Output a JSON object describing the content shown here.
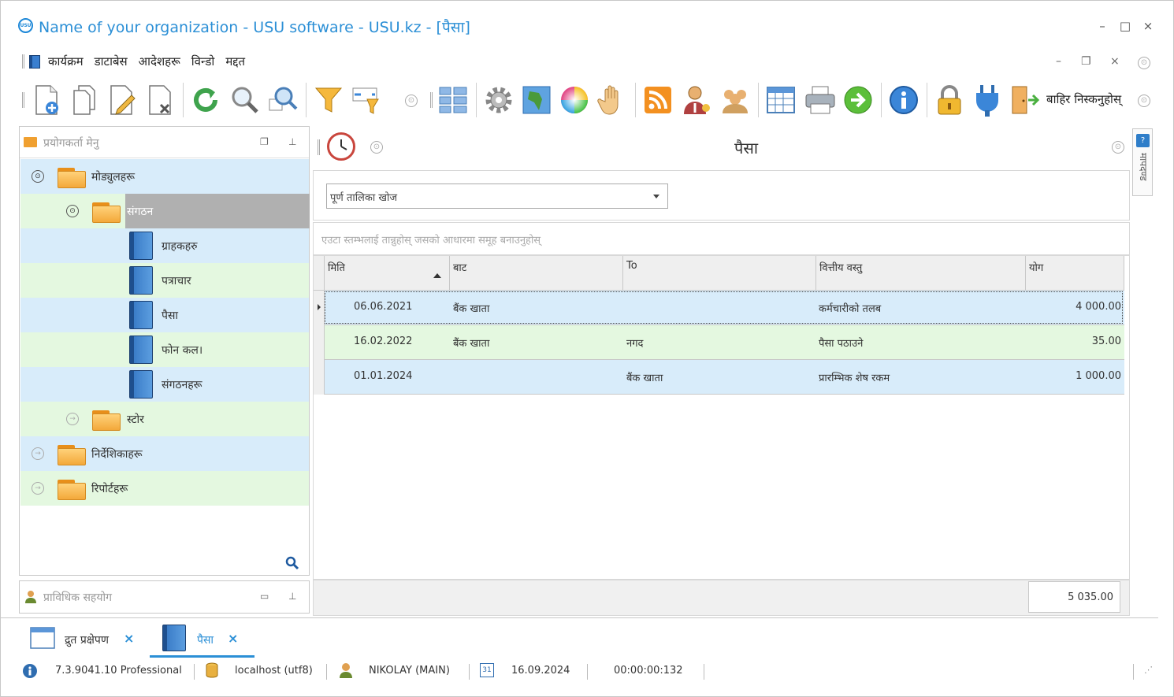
{
  "window": {
    "title": "Name of your organization - USU software - USU.kz - [पैसा]",
    "logo_text": "USU",
    "minimize": "–",
    "maximize": "□",
    "close": "×"
  },
  "menu": {
    "items": [
      "कार्यक्रम",
      "डाटाबेस",
      "आदेशहरू",
      "विन्डो",
      "मद्दत"
    ]
  },
  "mdi_controls": {
    "minimize": "–",
    "restore": "❐",
    "close": "×"
  },
  "toolbar": {
    "exit_label": "बाहिर निस्कनुहोस्"
  },
  "left_panel": {
    "title": "प्रयोगकर्ता मेनु",
    "tree": [
      {
        "label": "मोड्युलहरू",
        "type": "folder",
        "level": 0,
        "expanded": true
      },
      {
        "label": "संगठन",
        "type": "folder",
        "level": 1,
        "expanded": true,
        "selected": true
      },
      {
        "label": "ग्राहकहरु",
        "type": "book",
        "level": 2
      },
      {
        "label": "पत्राचार",
        "type": "book",
        "level": 2
      },
      {
        "label": "पैसा",
        "type": "book",
        "level": 2
      },
      {
        "label": "फोन कल।",
        "type": "book",
        "level": 2
      },
      {
        "label": "संगठनहरू",
        "type": "book",
        "level": 2
      },
      {
        "label": "स्टोर",
        "type": "folder",
        "level": 1,
        "expanded": false
      },
      {
        "label": "निर्देशिकाहरू",
        "type": "folder",
        "level": 0,
        "expanded": false
      },
      {
        "label": "रिपोर्टहरू",
        "type": "folder",
        "level": 0,
        "expanded": false
      }
    ]
  },
  "tech_panel": {
    "title": "प्राविधिक सहयोग"
  },
  "main": {
    "title": "पैसा",
    "filter": {
      "value": "पूर्ण तालिका खोज"
    },
    "group_hint": "एउटा स्तम्भलाई तान्नुहोस् जसको आधारमा समूह बनाउनुहोस्",
    "columns": [
      "मिति",
      "बाट",
      "To",
      "वित्तीय वस्तु",
      "योग"
    ],
    "rows": [
      {
        "date": "06.06.2021",
        "from": "बैंक खाता",
        "to": "",
        "item": "कर्मचारीको तलब",
        "sum": "4 000.00"
      },
      {
        "date": "16.02.2022",
        "from": "बैंक खाता",
        "to": "नगद",
        "item": "पैसा पठाउने",
        "sum": "35.00"
      },
      {
        "date": "01.01.2024",
        "from": "",
        "to": "बैंक खाता",
        "item": "प्रारम्भिक शेष रकम",
        "sum": "1 000.00"
      }
    ],
    "total": "5 035.00"
  },
  "side_tab": {
    "label": "मापदण्ड"
  },
  "tabs": [
    {
      "label": "द्रुत प्रक्षेपण",
      "close": "×",
      "active": false
    },
    {
      "label": "पैसा",
      "close": "×",
      "active": true
    }
  ],
  "status": {
    "version": "7.3.9041.10 Professional",
    "db": "localhost (utf8)",
    "user": "NIKOLAY (MAIN)",
    "calendar_day": "31",
    "date": "16.09.2024",
    "timer": "00:00:00:132"
  }
}
